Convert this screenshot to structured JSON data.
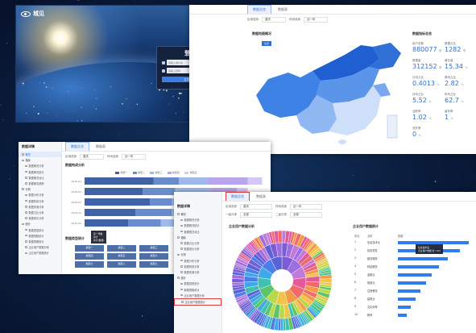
{
  "login": {
    "brand": "城见",
    "title": "登录",
    "username_placeholder": "请输入用户名",
    "password_placeholder": "请输入密码",
    "submit_label": "立即登录"
  },
  "map_window": {
    "tabs": [
      "数据总览",
      "数据表"
    ],
    "filters": [
      {
        "label": "区域选择",
        "value": "重庆"
      },
      {
        "label": "时间选择",
        "value": "近一年"
      }
    ],
    "section_title": "数据地图概况",
    "stats_title": "数据指标总览",
    "badge": "北京",
    "stats": [
      {
        "label": "用户总数",
        "value": "880077",
        "unit": "条"
      },
      {
        "label": "数据占比",
        "value": "1282",
        "unit": "条"
      },
      {
        "label": "数据量",
        "value": "312152",
        "unit": "条"
      },
      {
        "label": "增长量",
        "value": "15.34",
        "unit": "%"
      },
      {
        "label": "日均占比",
        "value": "0.4013",
        "unit": "%"
      },
      {
        "label": "周均占比",
        "value": "2.82",
        "unit": "%"
      },
      {
        "label": "月均占比",
        "value": "5.52",
        "unit": "%"
      },
      {
        "label": "年均占比",
        "value": "62.7",
        "unit": "%"
      },
      {
        "label": "活跃率",
        "value": "1.02",
        "unit": "%"
      },
      {
        "label": "留存率",
        "value": "1",
        "unit": "%"
      },
      {
        "label": "流失率",
        "value": "0",
        "unit": "%"
      }
    ],
    "colors": {
      "map_dark": "#1f5fd1",
      "map_mid": "#3f82e6",
      "map_light": "#8fb8f2",
      "map_pale": "#cddff9"
    }
  },
  "bars_window": {
    "sidebar_title": "数据详情",
    "sidebar_items": [
      "概况",
      "指标",
      "数据概况分析",
      "数据概况统计",
      "数据概况对比",
      "数据概况趋势",
      "分析",
      "数据分布分析",
      "数据构成分析",
      "数据来源分析",
      "数据占比分析",
      "数据增长分析",
      "统计",
      "数据类型统计",
      "数据规模统计",
      "数据周期统计",
      "企业用户数据分析",
      "企业用户数据统计"
    ],
    "tabs": [
      "数据总览",
      "数据表"
    ],
    "filters": [
      {
        "label": "区域选择",
        "value": "重庆"
      },
      {
        "label": "时间选择",
        "value": "近一年"
      }
    ],
    "section_title": "数据构成分析",
    "legend": [
      "类型一",
      "类型二",
      "类型三",
      "类型四",
      "类型五"
    ],
    "row_labels": [
      "2019-01",
      "2019-02",
      "2019-03",
      "2019-04",
      "2019-05"
    ],
    "tooltip": [
      "近一年数",
      "共计",
      "共计(数量)",
      "共计(总数)"
    ],
    "lower_title": "数据类型统计",
    "tiles": [
      "类型一",
      "类型二",
      "类型三",
      "类型四",
      "类型五",
      "类型六",
      "类型七",
      "类型八",
      "类型九"
    ]
  },
  "sun_window": {
    "sidebar_title": "数据详情",
    "sidebar_items": [
      "概况",
      "数据概况分析",
      "数据概况统计",
      "数据概况对比",
      "指标",
      "数据占比分析",
      "数据增长分析",
      "分析",
      "数据分布分析",
      "数据构成分析",
      "数据来源分析",
      "统计",
      "数据类型统计",
      "数据规模统计",
      "企业用户数据分析",
      "企业用户数据统计"
    ],
    "tabs": [
      "数据总览",
      "数据表"
    ],
    "filters": [
      {
        "label": "区域选择",
        "value": "重庆"
      },
      {
        "label": "时间选择",
        "value": "近一年"
      },
      {
        "label": "一级分类",
        "value": "全部"
      },
      {
        "label": "二级分类",
        "value": "全部"
      }
    ],
    "left_title": "企业用户数据分析",
    "right_title": "企业用户数据统计",
    "rank_headers": [
      "排名",
      "名称",
      "数据"
    ],
    "rank_rows": [
      {
        "no": "1",
        "name": "信息技术业",
        "value": 100
      },
      {
        "no": "2",
        "name": "批发零售",
        "value": 88
      },
      {
        "no": "3",
        "name": "租赁服务",
        "value": 70
      },
      {
        "no": "4",
        "name": "科技服务",
        "value": 58
      },
      {
        "no": "5",
        "name": "金融业",
        "value": 48
      },
      {
        "no": "6",
        "name": "制造业",
        "value": 40
      },
      {
        "no": "7",
        "name": "住宿餐饮",
        "value": 32
      },
      {
        "no": "8",
        "name": "建筑业",
        "value": 25
      },
      {
        "no": "9",
        "name": "文化体育",
        "value": 18
      },
      {
        "no": "10",
        "name": "教育",
        "value": 12
      }
    ],
    "tooltip": [
      "信息技术业",
      "企业用户数据(条) 100"
    ]
  }
}
